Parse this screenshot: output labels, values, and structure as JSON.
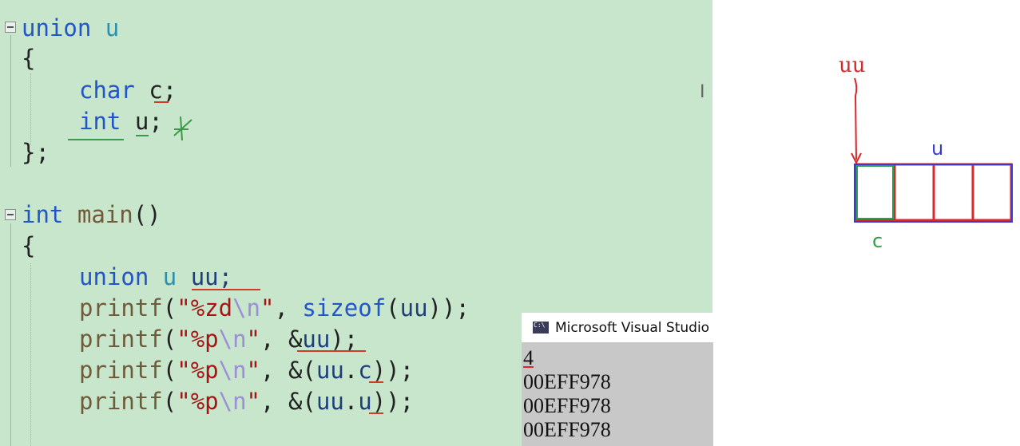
{
  "editor": {
    "code_lines": [
      "union u",
      "{",
      "char c;",
      "int u;",
      "};",
      "int main()",
      "{",
      "union u uu;",
      "printf(\"%zd\\n\", sizeof(uu));",
      "printf(\"%p\\n\", &uu);",
      "printf(\"%p\\n\", &(uu.c));",
      "printf(\"%p\\n\", &(uu.u));"
    ],
    "tokens": {
      "union": "union",
      "u": "u",
      "brace_open": "{",
      "brace_close_semi": "};",
      "char": "char",
      "c_semi": "c;",
      "int": "int",
      "u_semi": "u;",
      "main": "main",
      "parens": "()",
      "uu_semi": "uu;",
      "printf": "printf",
      "fmt_zd": "\"%zd",
      "fmt_p": "\"%p",
      "esc_n": "\\n",
      "quote": "\"",
      "comma": ", ",
      "sizeof": "sizeof",
      "uu": "uu",
      "amp": "&",
      "c": "c",
      "open_paren": "(",
      "close_paren_semi": ");",
      "close2_semi": "));",
      "dot": ".",
      "amp_open": "&("
    }
  },
  "console": {
    "title": "Microsoft Visual Studio",
    "output": [
      "4",
      "00EFF978",
      "00EFF978",
      "00EFF978"
    ]
  },
  "drawing": {
    "label_uu": "uu",
    "label_u": "u",
    "label_c": "c",
    "colors": {
      "red": "#d8282a",
      "blue": "#3a3ad0",
      "green": "#2aa04a"
    }
  },
  "colors": {
    "editor_bg": "#c7e6cc",
    "keyword": "#2255c8",
    "type": "#2b91af",
    "string": "#a31515",
    "escape": "#9d8fd6",
    "function": "#6f5a3a"
  }
}
